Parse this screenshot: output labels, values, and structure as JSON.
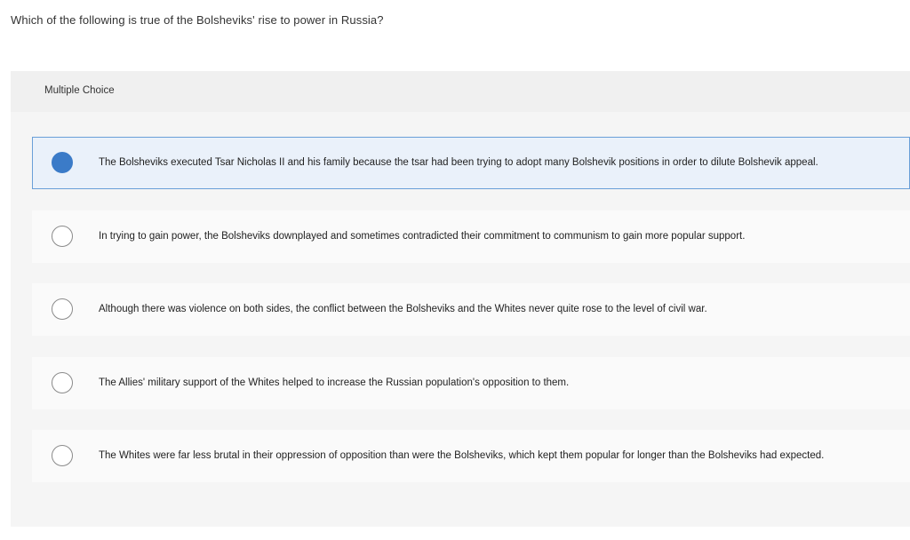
{
  "question": {
    "text": "Which of the following is true of the Bolsheviks' rise to power in Russia?"
  },
  "panel": {
    "header_label": "Multiple Choice"
  },
  "options": [
    {
      "text": "The Bolsheviks executed Tsar Nicholas II and his family because the tsar had been trying to adopt many Bolshevik positions in order to dilute Bolshevik appeal.",
      "selected": true
    },
    {
      "text": "In trying to gain power, the Bolsheviks downplayed and sometimes contradicted their commitment to communism to gain more popular support.",
      "selected": false
    },
    {
      "text": "Although there was violence on both sides, the conflict between the Bolsheviks and the Whites never quite rose to the level of civil war.",
      "selected": false
    },
    {
      "text": "The Allies' military support of the Whites helped to increase the Russian population's opposition to them.",
      "selected": false
    },
    {
      "text": "The Whites were far less brutal in their oppression of opposition than were the Bolsheviks, which kept them popular for longer than the Bolsheviks had expected.",
      "selected": false
    }
  ],
  "colors": {
    "selected_fill": "#3b7bc8",
    "selected_border": "#6a9fd8",
    "selected_background": "#eaf1fa"
  }
}
